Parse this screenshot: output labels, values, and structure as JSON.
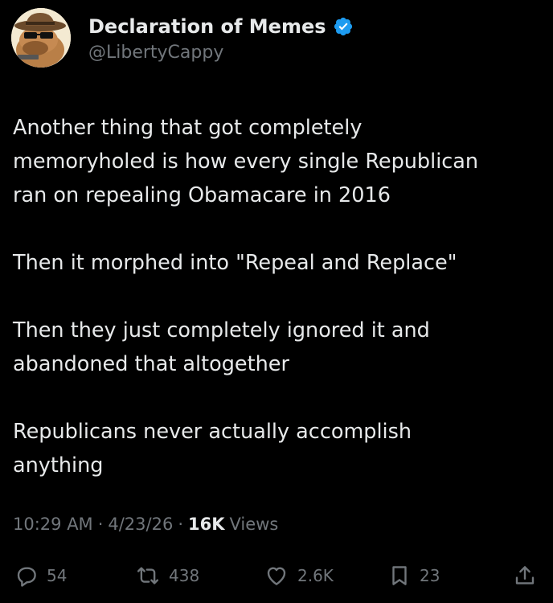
{
  "author": {
    "display_name": "Declaration of Memes",
    "handle": "@LibertyCappy",
    "verified": true,
    "avatar_icon": "capybara-cowboy-avatar"
  },
  "tweet": {
    "paragraphs": [
      [
        "Another thing that got completely",
        "memoryholed is how every single Republican",
        "ran on repealing Obamacare in 2016"
      ],
      [
        "Then it morphed into \"Repeal and Replace\""
      ],
      [
        "Then they just completely ignored it and",
        "abandoned that altogether"
      ],
      [
        "Republicans never actually accomplish",
        "anything"
      ]
    ]
  },
  "meta": {
    "time": "10:29 AM",
    "date": "4/23/26",
    "views_count": "16K",
    "views_label": "Views"
  },
  "actions": {
    "replies": "54",
    "reposts": "438",
    "likes": "2.6K",
    "bookmarks": "23"
  },
  "colors": {
    "background": "#000000",
    "text_primary": "#e7e9ea",
    "text_secondary": "#71767b",
    "verified_badge": "#1d9bf0"
  }
}
